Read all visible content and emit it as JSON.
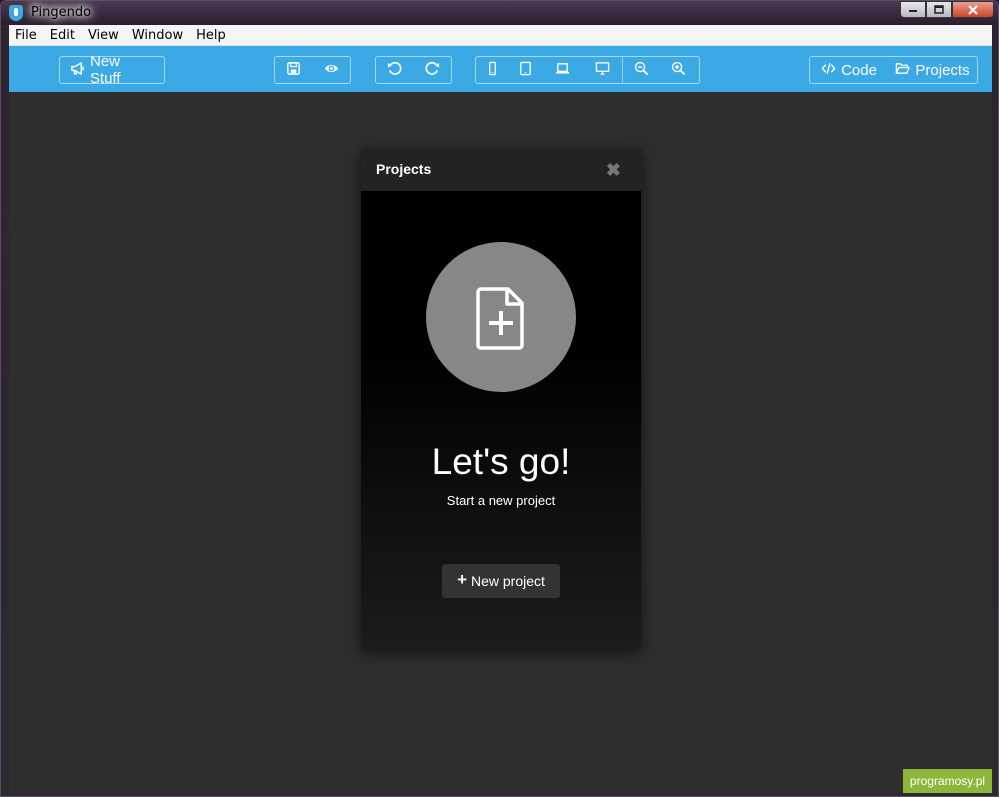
{
  "window": {
    "title": "Pingendo"
  },
  "menu": [
    "File",
    "Edit",
    "View",
    "Window",
    "Help"
  ],
  "toolbar": {
    "new_stuff_label": "New Stuff",
    "code_label": "Code",
    "projects_label": "Projects"
  },
  "modal": {
    "title": "Projects",
    "close_glyph": "✖",
    "heading": "Let's go!",
    "subtext": "Start a new project",
    "button_label": "New project",
    "button_icon": "+"
  },
  "watermark": "programosy.pl",
  "colors": {
    "toolbar": "#3aa9e4",
    "workspace": "#2e2e2e",
    "modal_header": "#232323",
    "circle": "#878787",
    "watermark": "#8cb73a"
  }
}
